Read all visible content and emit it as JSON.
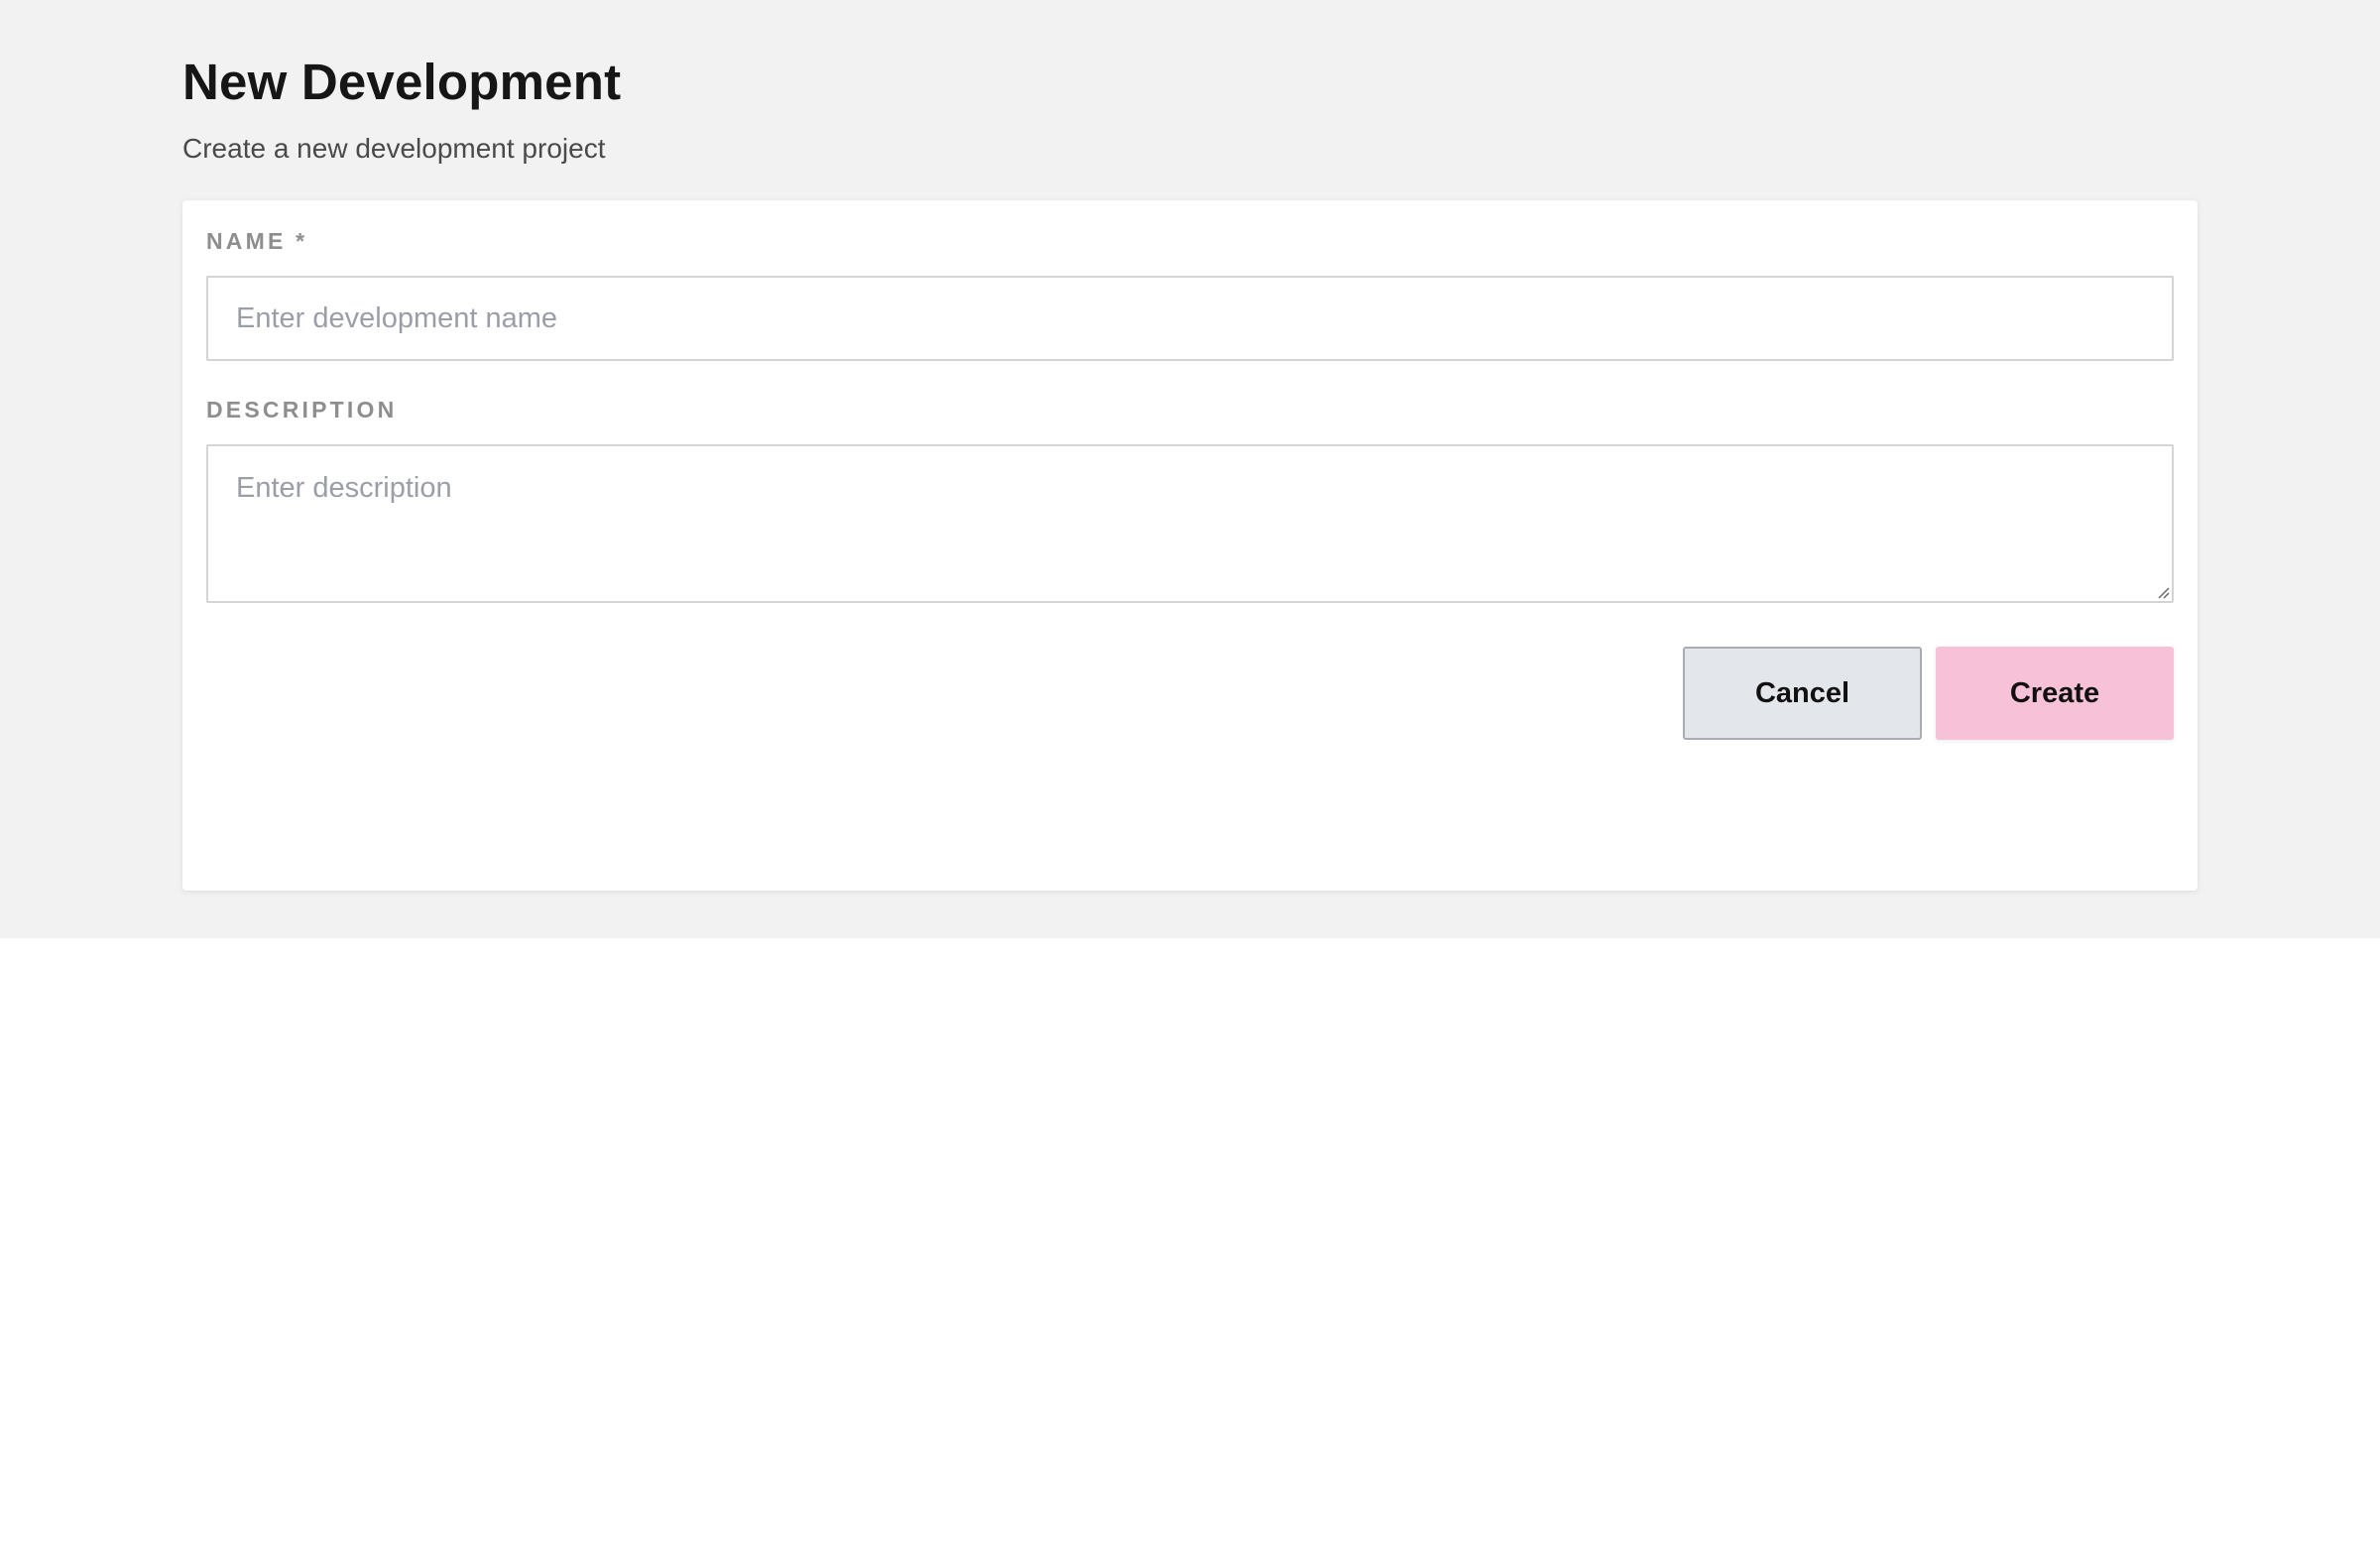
{
  "page": {
    "title": "New Development",
    "subtitle": "Create a new development project"
  },
  "form": {
    "name_label": "NAME *",
    "name_placeholder": "Enter development name",
    "name_value": "",
    "description_label": "DESCRIPTION",
    "description_placeholder": "Enter description",
    "description_value": ""
  },
  "actions": {
    "cancel_label": "Cancel",
    "create_label": "Create"
  },
  "colors": {
    "background": "#f2f2f2",
    "card": "#ffffff",
    "cancel_button": "#e3e6ea",
    "create_button": "#f7c1d8",
    "label_text": "#8e8e8e"
  },
  "icons": {
    "textarea_resize": "resize-grip-icon"
  }
}
